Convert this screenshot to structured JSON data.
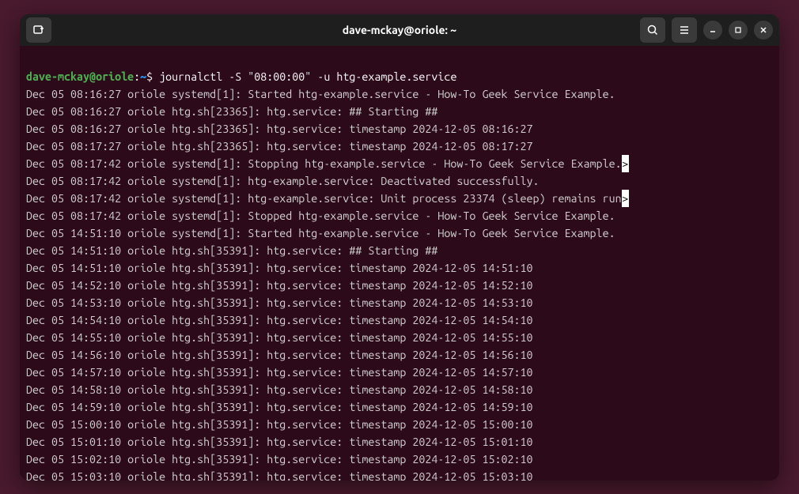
{
  "window": {
    "title": "dave-mckay@oriole: ~"
  },
  "prompt": {
    "user_host": "dave-mckay@oriole",
    "colon": ":",
    "path": "~",
    "dollar": "$ ",
    "command": "journalctl -S \"08:00:00\" -u htg-example.service"
  },
  "log_lines": [
    "Dec 05 08:16:27 oriole systemd[1]: Started htg-example.service - How-To Geek Service Example.",
    "Dec 05 08:16:27 oriole htg.sh[23365]: htg.service: ## Starting ##",
    "Dec 05 08:16:27 oriole htg.sh[23365]: htg.service: timestamp 2024-12-05 08:16:27",
    "Dec 05 08:17:27 oriole htg.sh[23365]: htg.service: timestamp 2024-12-05 08:17:27",
    "Dec 05 08:17:42 oriole systemd[1]: Stopping htg-example.service - How-To Geek Service Example.",
    "Dec 05 08:17:42 oriole systemd[1]: htg-example.service: Deactivated successfully.",
    "Dec 05 08:17:42 oriole systemd[1]: htg-example.service: Unit process 23374 (sleep) remains run",
    "Dec 05 08:17:42 oriole systemd[1]: Stopped htg-example.service - How-To Geek Service Example.",
    "Dec 05 14:51:10 oriole systemd[1]: Started htg-example.service - How-To Geek Service Example.",
    "Dec 05 14:51:10 oriole htg.sh[35391]: htg.service: ## Starting ##",
    "Dec 05 14:51:10 oriole htg.sh[35391]: htg.service: timestamp 2024-12-05 14:51:10",
    "Dec 05 14:52:10 oriole htg.sh[35391]: htg.service: timestamp 2024-12-05 14:52:10",
    "Dec 05 14:53:10 oriole htg.sh[35391]: htg.service: timestamp 2024-12-05 14:53:10",
    "Dec 05 14:54:10 oriole htg.sh[35391]: htg.service: timestamp 2024-12-05 14:54:10",
    "Dec 05 14:55:10 oriole htg.sh[35391]: htg.service: timestamp 2024-12-05 14:55:10",
    "Dec 05 14:56:10 oriole htg.sh[35391]: htg.service: timestamp 2024-12-05 14:56:10",
    "Dec 05 14:57:10 oriole htg.sh[35391]: htg.service: timestamp 2024-12-05 14:57:10",
    "Dec 05 14:58:10 oriole htg.sh[35391]: htg.service: timestamp 2024-12-05 14:58:10",
    "Dec 05 14:59:10 oriole htg.sh[35391]: htg.service: timestamp 2024-12-05 14:59:10",
    "Dec 05 15:00:10 oriole htg.sh[35391]: htg.service: timestamp 2024-12-05 15:00:10",
    "Dec 05 15:01:10 oriole htg.sh[35391]: htg.service: timestamp 2024-12-05 15:01:10",
    "Dec 05 15:02:10 oriole htg.sh[35391]: htg.service: timestamp 2024-12-05 15:02:10",
    "Dec 05 15:03:10 oriole htg.sh[35391]: htg.service: timestamp 2024-12-05 15:03:10"
  ],
  "truncated_indices": [
    4,
    6
  ],
  "truncate_char": ">"
}
